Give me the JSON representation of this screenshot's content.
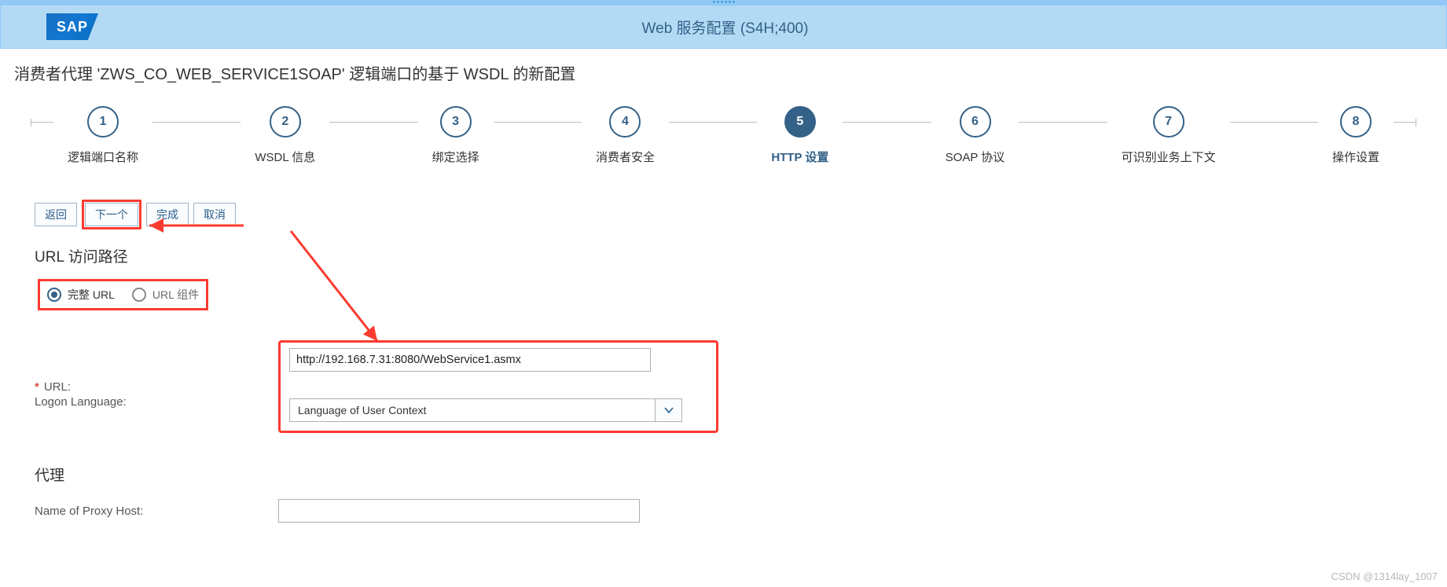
{
  "header": {
    "logo_text": "SAP",
    "title": "Web 服务配置 (S4H;400)"
  },
  "page_heading": "消费者代理 'ZWS_CO_WEB_SERVICE1SOAP' 逻辑端口的基于 WSDL 的新配置",
  "wizard": {
    "active_index": 4,
    "steps": [
      {
        "num": "1",
        "label": "逻辑端口名称"
      },
      {
        "num": "2",
        "label": "WSDL 信息"
      },
      {
        "num": "3",
        "label": "绑定选择"
      },
      {
        "num": "4",
        "label": "消费者安全"
      },
      {
        "num": "5",
        "label": "HTTP 设置"
      },
      {
        "num": "6",
        "label": "SOAP 协议"
      },
      {
        "num": "7",
        "label": "可识别业务上下文"
      },
      {
        "num": "8",
        "label": "操作设置"
      }
    ]
  },
  "buttons": {
    "back": "返回",
    "next": "下一个",
    "finish": "完成",
    "cancel": "取消"
  },
  "sections": {
    "url_access": "URL 访问路径",
    "proxy": "代理"
  },
  "radios": {
    "full_url": "完整 URL",
    "url_components": "URL 组件",
    "selected": "full_url"
  },
  "form": {
    "url_label": "URL:",
    "url_value": "http://192.168.7.31:8080/WebService1.asmx",
    "logon_language_label": "Logon Language:",
    "logon_language_value": "Language of User Context",
    "proxy_host_label": "Name of Proxy Host:",
    "proxy_host_value": ""
  },
  "watermark": "CSDN @1314lay_1007"
}
